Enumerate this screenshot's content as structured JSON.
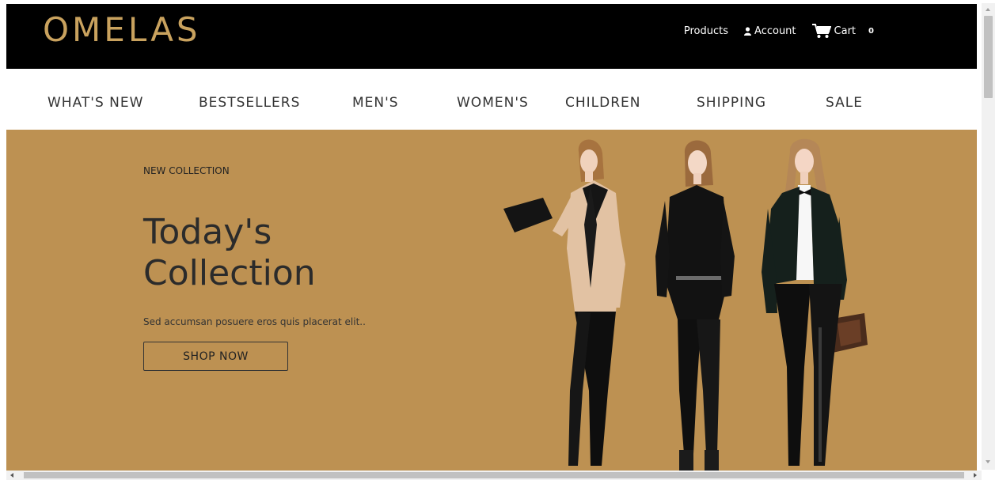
{
  "header": {
    "logo": "OMELAS",
    "links": {
      "products": "Products",
      "account": "Account",
      "cart": "Cart",
      "cart_count": "0"
    }
  },
  "nav": {
    "items": [
      "WHAT'S NEW",
      "BESTSELLERS",
      "MEN'S",
      "WOMEN'S",
      "CHILDREN",
      "SHIPPING",
      "SALE"
    ]
  },
  "hero": {
    "eyebrow": "NEW COLLECTION",
    "title": "Today's Collection",
    "subtitle": "Sed accumsan posuere eros quis placerat elit..",
    "button": "SHOP NOW"
  },
  "colors": {
    "header_bg": "#000000",
    "logo_gold": "#c9a25e",
    "hero_bg": "#bd9152"
  },
  "icons": {
    "account": "user-icon",
    "cart": "shopping-cart-icon"
  }
}
